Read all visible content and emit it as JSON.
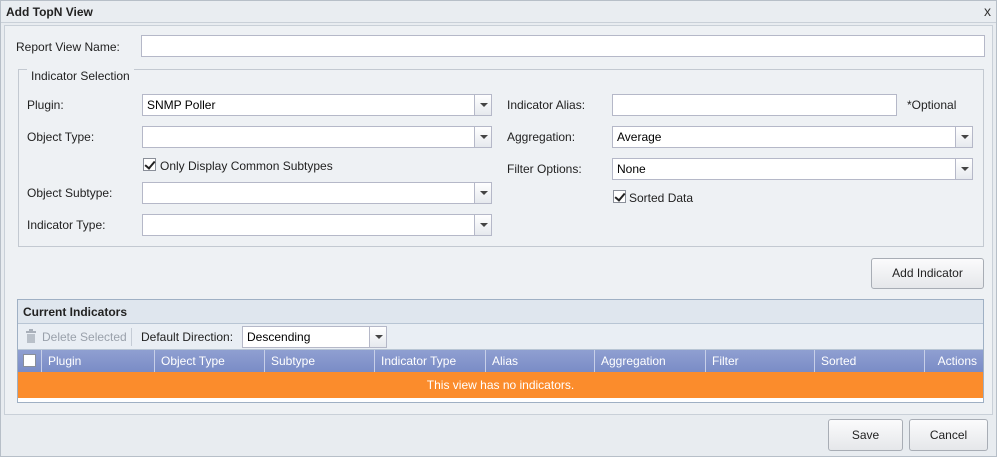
{
  "window": {
    "title": "Add TopN View",
    "close_symbol": "x"
  },
  "report_view_name": {
    "label": "Report View Name:",
    "value": ""
  },
  "indicator_selection": {
    "legend": "Indicator Selection",
    "plugin": {
      "label": "Plugin:",
      "value": "SNMP Poller"
    },
    "object_type": {
      "label": "Object Type:",
      "value": ""
    },
    "only_common_subtypes": {
      "label": "Only Display Common Subtypes",
      "checked": true
    },
    "object_subtype": {
      "label": "Object Subtype:",
      "value": ""
    },
    "indicator_type": {
      "label": "Indicator Type:",
      "value": ""
    },
    "indicator_alias": {
      "label": "Indicator Alias:",
      "value": "",
      "hint": "*Optional"
    },
    "aggregation": {
      "label": "Aggregation:",
      "value": "Average"
    },
    "filter_options": {
      "label": "Filter Options:",
      "value": "None"
    },
    "sorted_data": {
      "label": "Sorted Data",
      "checked": true
    }
  },
  "add_indicator_label": "Add Indicator",
  "current_indicators": {
    "title": "Current Indicators",
    "delete_selected_label": "Delete Selected",
    "default_direction_label": "Default Direction:",
    "default_direction_value": "Descending",
    "columns": [
      "Plugin",
      "Object Type",
      "Subtype",
      "Indicator Type",
      "Alias",
      "Aggregation",
      "Filter",
      "Sorted",
      "Actions"
    ],
    "empty_message": "This view has no indicators."
  },
  "footer": {
    "save_label": "Save",
    "cancel_label": "Cancel"
  },
  "colors": {
    "grid_header": "#7a8cc6",
    "empty_row": "#fb8c2c"
  }
}
